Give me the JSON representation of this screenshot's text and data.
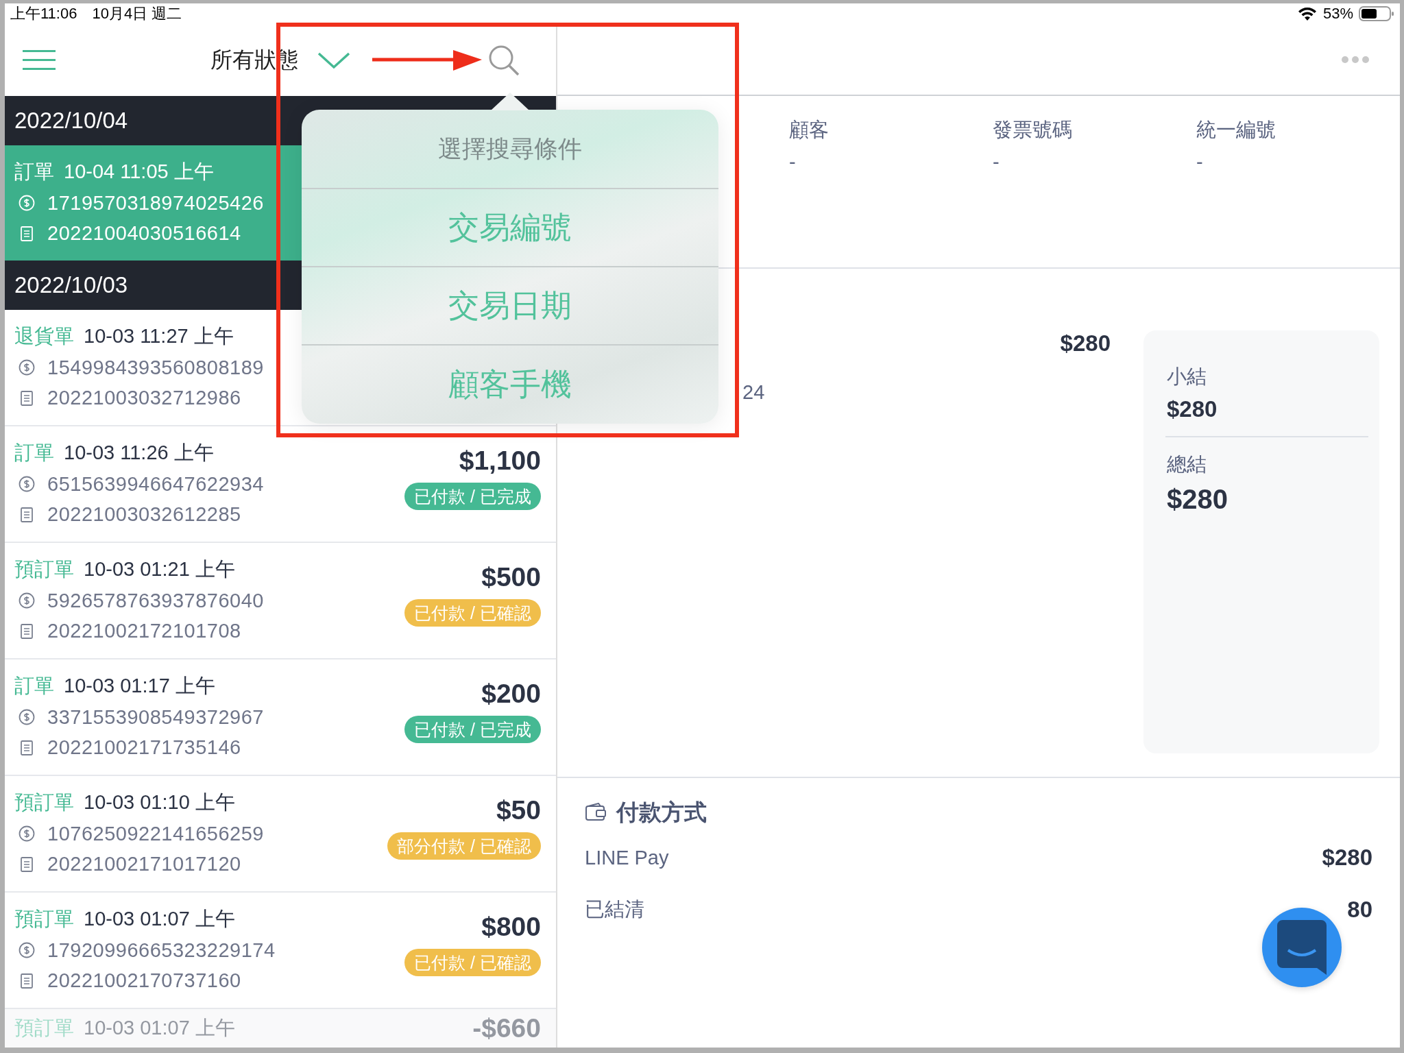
{
  "status_bar": {
    "time": "上午11:06",
    "date": "10月4日 週二",
    "battery": "53%"
  },
  "nav": {
    "title": "所有狀態"
  },
  "sections": [
    {
      "date": "2022/10/04",
      "orders": [
        {
          "type": "訂單",
          "time": "10-04 11:05 上午",
          "transaction_no": "1719570318974025426",
          "invoice_no": "20221004030516614",
          "selected": true,
          "faded": false
        }
      ]
    },
    {
      "date": "2022/10/03",
      "orders": [
        {
          "type": "退貨單",
          "time": "10-03 11:27 上午",
          "transaction_no": "1549984393560808189",
          "invoice_no": "20221003032712986",
          "selected": false,
          "faded": false
        },
        {
          "type": "訂單",
          "time": "10-03 11:26 上午",
          "transaction_no": "6515639946647622934",
          "invoice_no": "20221003032612285",
          "amount": "$1,100",
          "status": {
            "text": "已付款 / 已完成",
            "color": "#45b993"
          },
          "selected": false,
          "faded": false
        },
        {
          "type": "預訂單",
          "time": "10-03 01:21 上午",
          "transaction_no": "5926578763937876040",
          "invoice_no": "20221002172101708",
          "amount": "$500",
          "status": {
            "text": "已付款 / 已確認",
            "color": "#f0be4b"
          },
          "selected": false,
          "faded": false
        },
        {
          "type": "訂單",
          "time": "10-03 01:17 上午",
          "transaction_no": "3371553908549372967",
          "invoice_no": "20221002171735146",
          "amount": "$200",
          "status": {
            "text": "已付款 / 已完成",
            "color": "#45b993"
          },
          "selected": false,
          "faded": false
        },
        {
          "type": "預訂單",
          "time": "10-03 01:10 上午",
          "transaction_no": "1076250922141656259",
          "invoice_no": "20221002171017120",
          "amount": "$50",
          "status": {
            "text": "部分付款 / 已確認",
            "color": "#f0be4b"
          },
          "selected": false,
          "faded": false
        },
        {
          "type": "預訂單",
          "time": "10-03 01:07 上午",
          "transaction_no": "17920996665323229174",
          "invoice_no": "20221002170737160",
          "amount": "$800",
          "status": {
            "text": "已付款 / 已確認",
            "color": "#f0be4b"
          },
          "selected": false,
          "faded": false
        },
        {
          "type": "預訂單",
          "time": "10-03 01:07 上午",
          "amount": "-$660",
          "selected": false,
          "faded": true
        }
      ]
    }
  ],
  "popover": {
    "title": "選擇搜尋條件",
    "options": [
      "交易編號",
      "交易日期",
      "顧客手機"
    ]
  },
  "detail": {
    "fields": [
      {
        "label": "顧客",
        "value": "-"
      },
      {
        "label": "發票號碼",
        "value": "-"
      },
      {
        "label": "統一編號",
        "value": "-"
      }
    ],
    "line_amount": "$280",
    "partial_text": "24",
    "summary": {
      "subtotal_label": "小結",
      "subtotal": "$280",
      "total_label": "總結",
      "total": "$280"
    },
    "payment": {
      "title": "付款方式",
      "rows": [
        {
          "label": "LINE Pay",
          "amount": "$280"
        },
        {
          "label": "已結清",
          "amount": "80"
        }
      ]
    }
  }
}
